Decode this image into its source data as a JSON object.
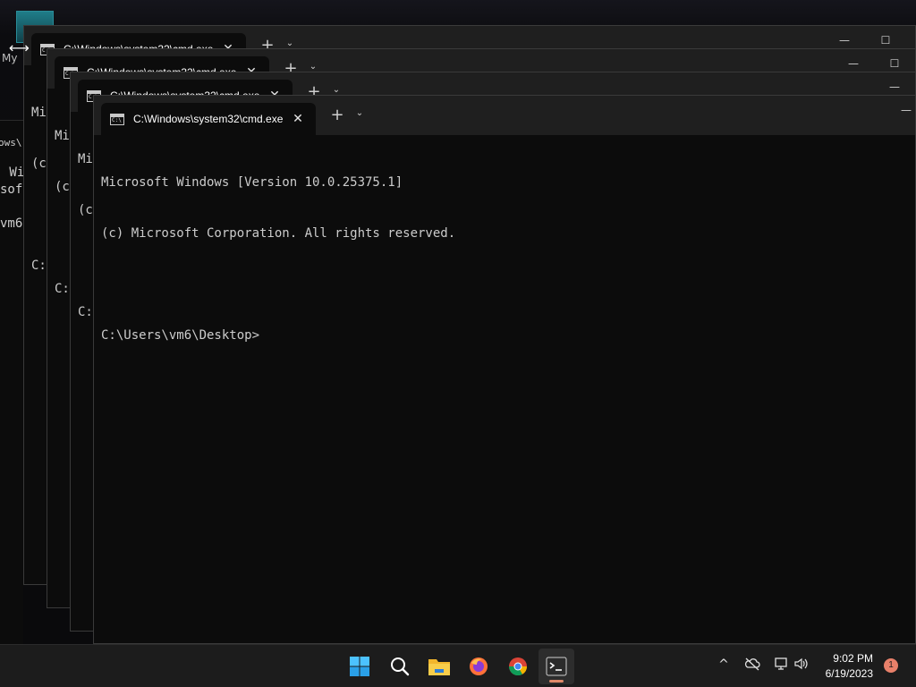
{
  "desktop": {
    "icon_label": "My",
    "cursor_glyph": "⟷"
  },
  "background_console": {
    "lines": [
      "ows\\",
      " Wi",
      "sof",
      "",
      "vm6"
    ]
  },
  "windows": [
    {
      "tab_title": "C:\\Windows\\system32\\cmd.exe",
      "visible_lines": [
        "Mi",
        "(c",
        "",
        "C:"
      ]
    },
    {
      "tab_title": "C:\\Windows\\system32\\cmd.exe",
      "visible_lines": [
        "Mi",
        "(c",
        "",
        "C:"
      ]
    },
    {
      "tab_title": "C:\\Windows\\system32\\cmd.exe",
      "visible_lines": [
        "Mi",
        "(c",
        "",
        "C:"
      ]
    },
    {
      "tab_title": "C:\\Windows\\system32\\cmd.exe",
      "visible_lines": [
        "Microsoft Windows [Version 10.0.25375.1]",
        "(c) Microsoft Corporation. All rights reserved.",
        "",
        "C:\\Users\\vm6\\Desktop>"
      ]
    }
  ],
  "titlebar_controls": {
    "close_tab": "✕",
    "new_tab": "+",
    "dropdown": "⌄",
    "minimize": "—",
    "maximize": "☐"
  },
  "taskbar": {
    "apps": [
      {
        "name": "Start",
        "icon": "windows-logo"
      },
      {
        "name": "Search",
        "icon": "search-icon"
      },
      {
        "name": "File Explorer",
        "icon": "folder-icon"
      },
      {
        "name": "Firefox",
        "icon": "firefox-icon"
      },
      {
        "name": "Chrome",
        "icon": "chrome-icon"
      },
      {
        "name": "Terminal",
        "icon": "terminal-icon",
        "active": true
      }
    ],
    "tray": {
      "chevron": "^",
      "time": "9:02 PM",
      "date": "6/19/2023",
      "notification_count": "1"
    }
  },
  "colors": {
    "console_bg": "#0c0c0c",
    "titlebar_bg": "#1f1f1f",
    "taskbar_bg": "#1c1c1c",
    "accent": "#e08a6a"
  }
}
